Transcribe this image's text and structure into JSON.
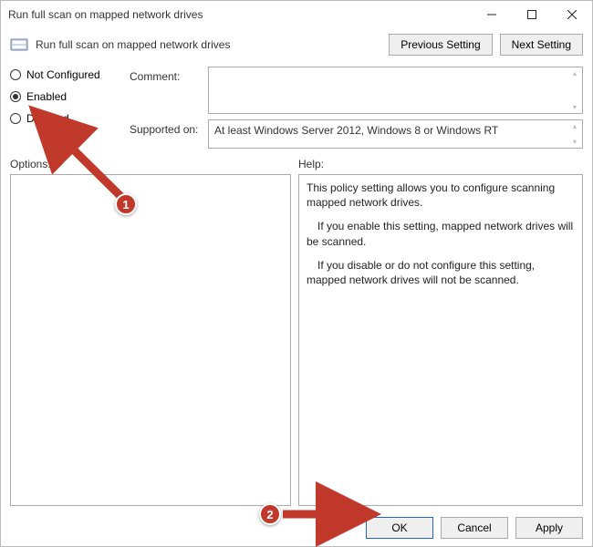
{
  "title": "Run full scan on mapped network drives",
  "header": {
    "policy_name": "Run full scan on mapped network drives",
    "previous_setting": "Previous Setting",
    "next_setting": "Next Setting"
  },
  "radios": {
    "not_configured": "Not Configured",
    "enabled": "Enabled",
    "disabled": "Disabled",
    "selected": "enabled"
  },
  "labels": {
    "comment": "Comment:",
    "supported_on": "Supported on:",
    "options": "Options:",
    "help": "Help:"
  },
  "fields": {
    "comment": "",
    "supported_on": "At least Windows Server 2012, Windows 8 or Windows RT"
  },
  "help": {
    "p1": "This policy setting allows you to configure scanning mapped network drives.",
    "p2": "If you enable this setting, mapped network drives will be scanned.",
    "p3": "If you disable or do not configure this setting, mapped network drives will not be scanned."
  },
  "footer": {
    "ok": "OK",
    "cancel": "Cancel",
    "apply": "Apply"
  },
  "annotations": {
    "badge1": "1",
    "badge2": "2"
  }
}
